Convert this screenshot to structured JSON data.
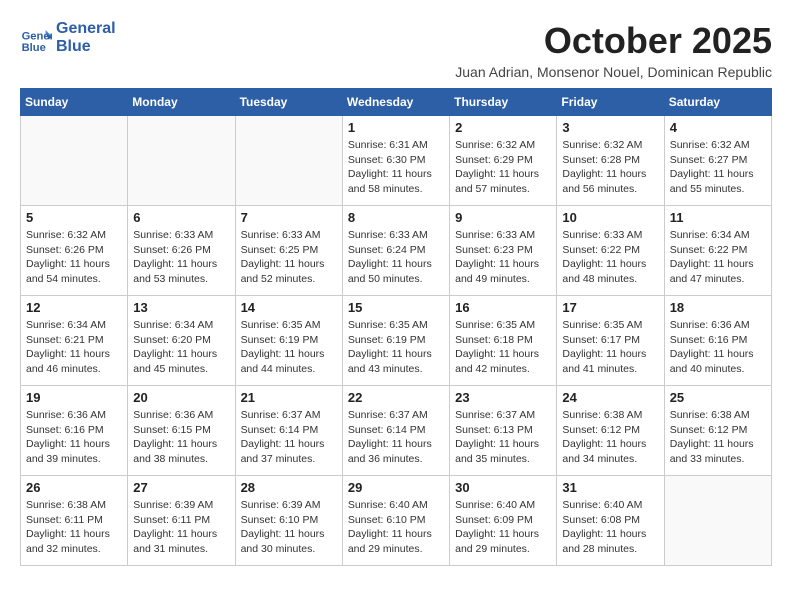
{
  "header": {
    "logo_line1": "General",
    "logo_line2": "Blue",
    "month_title": "October 2025",
    "subtitle": "Juan Adrian, Monsenor Nouel, Dominican Republic"
  },
  "weekdays": [
    "Sunday",
    "Monday",
    "Tuesday",
    "Wednesday",
    "Thursday",
    "Friday",
    "Saturday"
  ],
  "weeks": [
    [
      {
        "day": "",
        "info": ""
      },
      {
        "day": "",
        "info": ""
      },
      {
        "day": "",
        "info": ""
      },
      {
        "day": "1",
        "info": "Sunrise: 6:31 AM\nSunset: 6:30 PM\nDaylight: 11 hours\nand 58 minutes."
      },
      {
        "day": "2",
        "info": "Sunrise: 6:32 AM\nSunset: 6:29 PM\nDaylight: 11 hours\nand 57 minutes."
      },
      {
        "day": "3",
        "info": "Sunrise: 6:32 AM\nSunset: 6:28 PM\nDaylight: 11 hours\nand 56 minutes."
      },
      {
        "day": "4",
        "info": "Sunrise: 6:32 AM\nSunset: 6:27 PM\nDaylight: 11 hours\nand 55 minutes."
      }
    ],
    [
      {
        "day": "5",
        "info": "Sunrise: 6:32 AM\nSunset: 6:26 PM\nDaylight: 11 hours\nand 54 minutes."
      },
      {
        "day": "6",
        "info": "Sunrise: 6:33 AM\nSunset: 6:26 PM\nDaylight: 11 hours\nand 53 minutes."
      },
      {
        "day": "7",
        "info": "Sunrise: 6:33 AM\nSunset: 6:25 PM\nDaylight: 11 hours\nand 52 minutes."
      },
      {
        "day": "8",
        "info": "Sunrise: 6:33 AM\nSunset: 6:24 PM\nDaylight: 11 hours\nand 50 minutes."
      },
      {
        "day": "9",
        "info": "Sunrise: 6:33 AM\nSunset: 6:23 PM\nDaylight: 11 hours\nand 49 minutes."
      },
      {
        "day": "10",
        "info": "Sunrise: 6:33 AM\nSunset: 6:22 PM\nDaylight: 11 hours\nand 48 minutes."
      },
      {
        "day": "11",
        "info": "Sunrise: 6:34 AM\nSunset: 6:22 PM\nDaylight: 11 hours\nand 47 minutes."
      }
    ],
    [
      {
        "day": "12",
        "info": "Sunrise: 6:34 AM\nSunset: 6:21 PM\nDaylight: 11 hours\nand 46 minutes."
      },
      {
        "day": "13",
        "info": "Sunrise: 6:34 AM\nSunset: 6:20 PM\nDaylight: 11 hours\nand 45 minutes."
      },
      {
        "day": "14",
        "info": "Sunrise: 6:35 AM\nSunset: 6:19 PM\nDaylight: 11 hours\nand 44 minutes."
      },
      {
        "day": "15",
        "info": "Sunrise: 6:35 AM\nSunset: 6:19 PM\nDaylight: 11 hours\nand 43 minutes."
      },
      {
        "day": "16",
        "info": "Sunrise: 6:35 AM\nSunset: 6:18 PM\nDaylight: 11 hours\nand 42 minutes."
      },
      {
        "day": "17",
        "info": "Sunrise: 6:35 AM\nSunset: 6:17 PM\nDaylight: 11 hours\nand 41 minutes."
      },
      {
        "day": "18",
        "info": "Sunrise: 6:36 AM\nSunset: 6:16 PM\nDaylight: 11 hours\nand 40 minutes."
      }
    ],
    [
      {
        "day": "19",
        "info": "Sunrise: 6:36 AM\nSunset: 6:16 PM\nDaylight: 11 hours\nand 39 minutes."
      },
      {
        "day": "20",
        "info": "Sunrise: 6:36 AM\nSunset: 6:15 PM\nDaylight: 11 hours\nand 38 minutes."
      },
      {
        "day": "21",
        "info": "Sunrise: 6:37 AM\nSunset: 6:14 PM\nDaylight: 11 hours\nand 37 minutes."
      },
      {
        "day": "22",
        "info": "Sunrise: 6:37 AM\nSunset: 6:14 PM\nDaylight: 11 hours\nand 36 minutes."
      },
      {
        "day": "23",
        "info": "Sunrise: 6:37 AM\nSunset: 6:13 PM\nDaylight: 11 hours\nand 35 minutes."
      },
      {
        "day": "24",
        "info": "Sunrise: 6:38 AM\nSunset: 6:12 PM\nDaylight: 11 hours\nand 34 minutes."
      },
      {
        "day": "25",
        "info": "Sunrise: 6:38 AM\nSunset: 6:12 PM\nDaylight: 11 hours\nand 33 minutes."
      }
    ],
    [
      {
        "day": "26",
        "info": "Sunrise: 6:38 AM\nSunset: 6:11 PM\nDaylight: 11 hours\nand 32 minutes."
      },
      {
        "day": "27",
        "info": "Sunrise: 6:39 AM\nSunset: 6:11 PM\nDaylight: 11 hours\nand 31 minutes."
      },
      {
        "day": "28",
        "info": "Sunrise: 6:39 AM\nSunset: 6:10 PM\nDaylight: 11 hours\nand 30 minutes."
      },
      {
        "day": "29",
        "info": "Sunrise: 6:40 AM\nSunset: 6:10 PM\nDaylight: 11 hours\nand 29 minutes."
      },
      {
        "day": "30",
        "info": "Sunrise: 6:40 AM\nSunset: 6:09 PM\nDaylight: 11 hours\nand 29 minutes."
      },
      {
        "day": "31",
        "info": "Sunrise: 6:40 AM\nSunset: 6:08 PM\nDaylight: 11 hours\nand 28 minutes."
      },
      {
        "day": "",
        "info": ""
      }
    ]
  ]
}
